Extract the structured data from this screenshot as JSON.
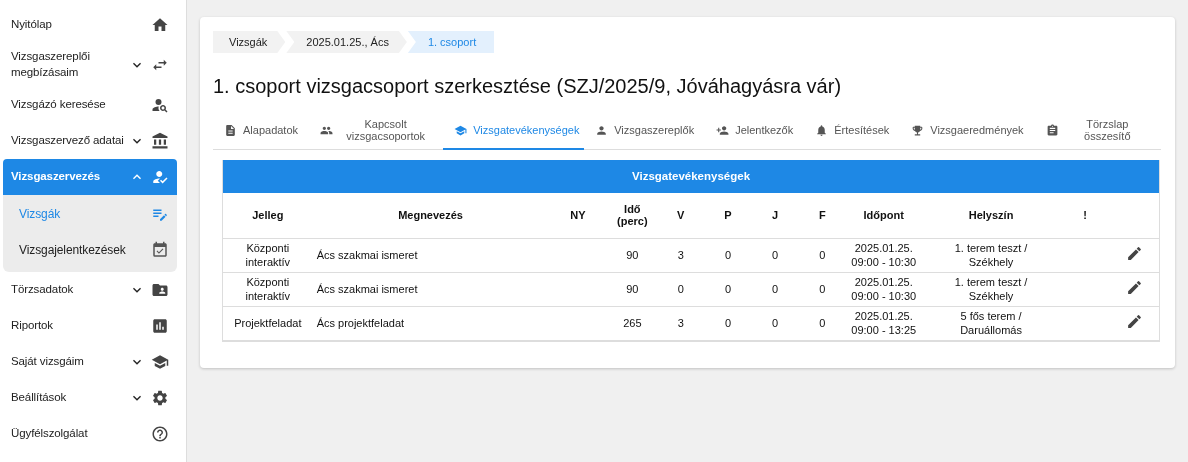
{
  "sidebar": {
    "items": [
      {
        "label": "Nyitólap",
        "selected": false
      },
      {
        "label": "Vizsgaszereplői megbízásaim",
        "selected": false,
        "expanded": false
      },
      {
        "label": "Vizsgázó keresése",
        "selected": false
      },
      {
        "label": "Vizsgaszervező adatai",
        "selected": false,
        "expanded": false
      },
      {
        "label": "Vizsgaszervezés",
        "selected": true,
        "expanded": true,
        "children": [
          {
            "label": "Vizsgák",
            "selected": true
          },
          {
            "label": "Vizsgajelentkezések",
            "selected": false
          }
        ]
      },
      {
        "label": "Törzsadatok",
        "selected": false,
        "expanded": false
      },
      {
        "label": "Riportok",
        "selected": false
      },
      {
        "label": "Saját vizsgáim",
        "selected": false,
        "expanded": false
      },
      {
        "label": "Beállítások",
        "selected": false,
        "expanded": false
      },
      {
        "label": "Ügyfélszolgálat",
        "selected": false
      }
    ]
  },
  "breadcrumb": [
    {
      "label": "Vizsgák",
      "selected": false
    },
    {
      "label": "2025.01.25., Ács",
      "selected": false
    },
    {
      "label": "1. csoport",
      "selected": true
    }
  ],
  "title": "1. csoport vizsgacsoport szerkesztése (SZJ/2025/9, Jóváhagyásra vár)",
  "tabs": [
    {
      "label": "Alapadatok",
      "selected": false
    },
    {
      "label": "Kapcsolt vizsgacsoportok",
      "selected": false
    },
    {
      "label": "Vizsgatevékenységek",
      "selected": true
    },
    {
      "label": "Vizsgaszereplők",
      "selected": false
    },
    {
      "label": "Jelentkezők",
      "selected": false
    },
    {
      "label": "Értesítések",
      "selected": false
    },
    {
      "label": "Vizsgaeredmények",
      "selected": false
    },
    {
      "label": "Törzslap összesítő",
      "selected": false
    }
  ],
  "table": {
    "title": "Vizsgatevékenységek",
    "columns": [
      "Jelleg",
      "Megnevezés",
      "NY",
      "Idő (perc)",
      "V",
      "P",
      "J",
      "F",
      "Időpont",
      "Helyszín",
      "!"
    ],
    "rows": [
      {
        "jelleg": "Központi interaktív",
        "megnevezes": "Ács szakmai ismeret",
        "ido": "90",
        "v": "3",
        "p": "0",
        "j": "0",
        "f": "0",
        "idopont": "2025.01.25. 09:00 - 10:30",
        "helyszin": "1. terem teszt / Székhely"
      },
      {
        "jelleg": "Központi interaktív",
        "megnevezes": "Ács szakmai ismeret",
        "ido": "90",
        "v": "0",
        "p": "0",
        "j": "0",
        "f": "0",
        "idopont": "2025.01.25. 09:00 - 10:30",
        "helyszin": "1. terem teszt / Székhely"
      },
      {
        "jelleg": "Projektfeladat",
        "megnevezes": "Ács projektfeladat",
        "ido": "265",
        "v": "3",
        "p": "0",
        "j": "0",
        "f": "0",
        "idopont": "2025.01.25. 09:00 - 13:25",
        "helyszin": "5 fős terem / Daruállomás"
      }
    ]
  }
}
